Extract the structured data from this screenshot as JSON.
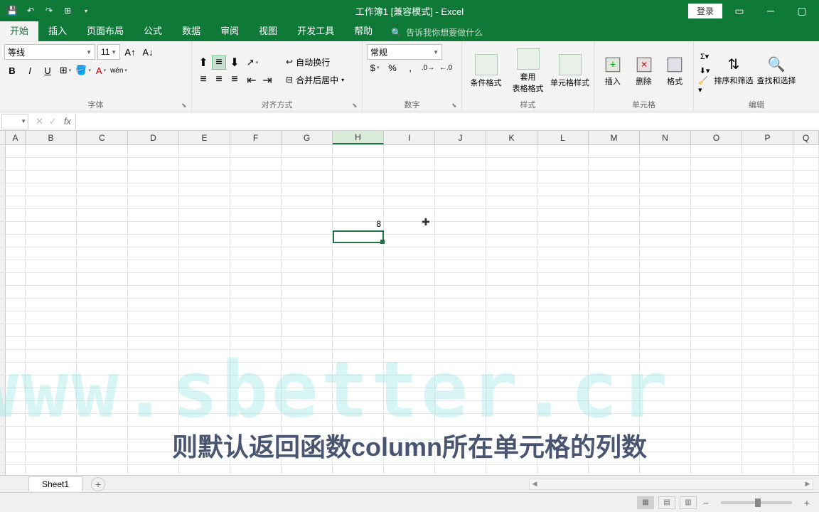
{
  "title": "工作簿1  [兼容模式]  -  Excel",
  "login": "登录",
  "tabs": {
    "home": "开始",
    "insert": "插入",
    "layout": "页面布局",
    "formulas": "公式",
    "data": "数据",
    "review": "审阅",
    "view": "视图",
    "dev": "开发工具",
    "help": "帮助"
  },
  "tell_me": "告诉我你想要做什么",
  "font": {
    "name": "等线",
    "size": "11",
    "group_label": "字体"
  },
  "align": {
    "wrap": "自动换行",
    "merge": "合并后居中",
    "group_label": "对齐方式"
  },
  "number": {
    "format": "常规",
    "group_label": "数字"
  },
  "styles": {
    "cond": "条件格式",
    "table": "套用\n表格格式",
    "cell": "单元格样式",
    "group_label": "样式"
  },
  "cells": {
    "insert": "插入",
    "delete": "删除",
    "format": "格式",
    "group_label": "单元格"
  },
  "editing": {
    "sort": "排序和筛选",
    "find": "查找和选择",
    "group_label": "编辑"
  },
  "columns": [
    "A",
    "B",
    "C",
    "D",
    "E",
    "F",
    "G",
    "H",
    "I",
    "J",
    "K",
    "L",
    "M",
    "N",
    "O",
    "P",
    "Q"
  ],
  "selected_column": "H",
  "cell_data": {
    "value": "8"
  },
  "watermark": "www.sbetter.cr",
  "subtitle": "则默认返回函数column所在单元格的列数",
  "sheet_name": "Sheet1"
}
